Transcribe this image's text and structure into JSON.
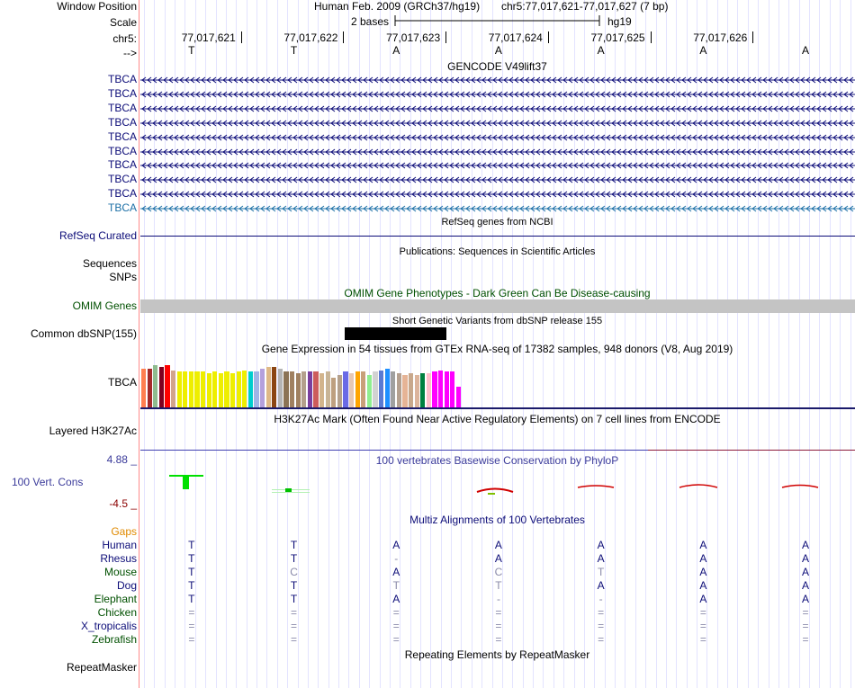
{
  "header": {
    "window_position_label": "Window Position",
    "scale_label": "Scale",
    "chrom_label": "chr5:",
    "strand_label": "-->",
    "assembly_title": "Human Feb. 2009 (GRCh37/hg19)",
    "position": "chr5:77,017,621-77,017,627 (7 bp)",
    "scale_text": "2 bases",
    "db": "hg19",
    "coords": [
      "77,017,621",
      "77,017,622",
      "77,017,623",
      "77,017,624",
      "77,017,625",
      "77,017,626"
    ],
    "bases": [
      "T",
      "T",
      "A",
      "A",
      "A",
      "A",
      "A"
    ]
  },
  "gencode": {
    "title": "GENCODE V49lift37",
    "transcripts": [
      "TBCA",
      "TBCA",
      "TBCA",
      "TBCA",
      "TBCA",
      "TBCA",
      "TBCA",
      "TBCA",
      "TBCA",
      "TBCA"
    ],
    "color": "#0c0c78",
    "highlight_color": "#1b6fa6"
  },
  "refseq": {
    "title": "RefSeq genes from NCBI",
    "label": "RefSeq Curated"
  },
  "publications": {
    "title": "Publications: Sequences in Scientific Articles",
    "labels": [
      "Sequences",
      "SNPs"
    ]
  },
  "omim": {
    "title": "OMIM Gene Phenotypes - Dark Green Can Be Disease-causing",
    "label": "OMIM Genes",
    "color": "#005000"
  },
  "dbsnp": {
    "title": "Short Genetic Variants from dbSNP release 155",
    "label": "Common dbSNP(155)"
  },
  "gtex": {
    "title": "Gene Expression in 54 tissues from GTEx RNA-seq of 17382 samples, 948 donors (V8, Aug 2019)",
    "label": "TBCA",
    "tissue_values": [
      0.72,
      0.72,
      0.78,
      0.75,
      0.78,
      0.69,
      0.66,
      0.66,
      0.66,
      0.66,
      0.66,
      0.63,
      0.66,
      0.63,
      0.66,
      0.63,
      0.66,
      0.69,
      0.66,
      0.66,
      0.72,
      0.75,
      0.75,
      0.72,
      0.66,
      0.66,
      0.63,
      0.66,
      0.66,
      0.66,
      0.63,
      0.66,
      0.55,
      0.6,
      0.66,
      0.63,
      0.66,
      0.66,
      0.6,
      0.66,
      0.69,
      0.72,
      0.66,
      0.63,
      0.6,
      0.63,
      0.6,
      0.63,
      0.63,
      0.66,
      0.69,
      0.66,
      0.66,
      0.38
    ],
    "tissue_colors": [
      "#ff7f50",
      "#a52a2a",
      "#8fbc8f",
      "#800020",
      "#ff0000",
      "#d2a48c",
      "#eeee00",
      "#eeee00",
      "#eeee00",
      "#eeee00",
      "#eeee00",
      "#eeee00",
      "#eeee00",
      "#eeee00",
      "#eeee00",
      "#eeee00",
      "#eeee00",
      "#eeee00",
      "#00cdcd",
      "#a0b4e6",
      "#b4a0dc",
      "#deb887",
      "#8b4513",
      "#b4b4b4",
      "#8b7355",
      "#a08060",
      "#a08060",
      "#b4a08c",
      "#7b3f9e",
      "#cd5c5c",
      "#d2b48c",
      "#c8b496",
      "#bea080",
      "#b4a08c",
      "#6a6ae6",
      "#e6c8b4",
      "#ffa500",
      "#c8a07a",
      "#90ee90",
      "#d2d2d2",
      "#5a7ad2",
      "#1e90ff",
      "#a0a0a0",
      "#b4a090",
      "#e6b496",
      "#c8a88c",
      "#dcb49c",
      "#008040",
      "#ffc0cb",
      "#ff00ff",
      "#ff00ff",
      "#ff00ff",
      "#ff00ff",
      "#ff00ff"
    ]
  },
  "h3k27ac": {
    "title": "H3K27Ac Mark (Often Found Near Active Regulatory Elements) on 7 cell lines from ENCODE",
    "label": "Layered H3K27Ac"
  },
  "phylop": {
    "title": "100 vertebrates Basewise Conservation by PhyloP",
    "label": "100 Vert. Cons",
    "max": "4.88 _",
    "min": "-4.5 _",
    "color": "#3a3a9a",
    "min_color": "#8b0000"
  },
  "multiz": {
    "title": "Multiz Alignments of 100 Vertebrates",
    "gaps_label": "Gaps",
    "species": [
      {
        "name": "Human",
        "color": "#0c0c78",
        "bases": [
          "T",
          "T",
          "A",
          "A",
          "A",
          "A",
          "A"
        ]
      },
      {
        "name": "Rhesus",
        "color": "#0c0c78",
        "bases": [
          "T",
          "T",
          "-",
          "A",
          "A",
          "A",
          "A"
        ]
      },
      {
        "name": "Mouse",
        "color": "#005000",
        "bases": [
          "T",
          "C",
          "A",
          "C",
          "T",
          "A",
          "A"
        ]
      },
      {
        "name": "Dog",
        "color": "#0c0c78",
        "bases": [
          "T",
          "T",
          "T",
          "T",
          "A",
          "A",
          "A"
        ]
      },
      {
        "name": "Elephant",
        "color": "#005000",
        "bases": [
          "T",
          "T",
          "A",
          "-",
          "-",
          "A",
          "A"
        ]
      },
      {
        "name": "Chicken",
        "color": "#005000",
        "bases": [
          "=",
          "=",
          "=",
          "=",
          "=",
          "=",
          "="
        ]
      },
      {
        "name": "X_tropicalis",
        "color": "#0c0c78",
        "bases": [
          "=",
          "=",
          "=",
          "=",
          "=",
          "=",
          "="
        ]
      },
      {
        "name": "Zebrafish",
        "color": "#005000",
        "bases": [
          "=",
          "=",
          "=",
          "=",
          "=",
          "=",
          "="
        ]
      }
    ]
  },
  "repeatmasker": {
    "title": "Repeating Elements by RepeatMasker",
    "label": "RepeatMasker"
  }
}
